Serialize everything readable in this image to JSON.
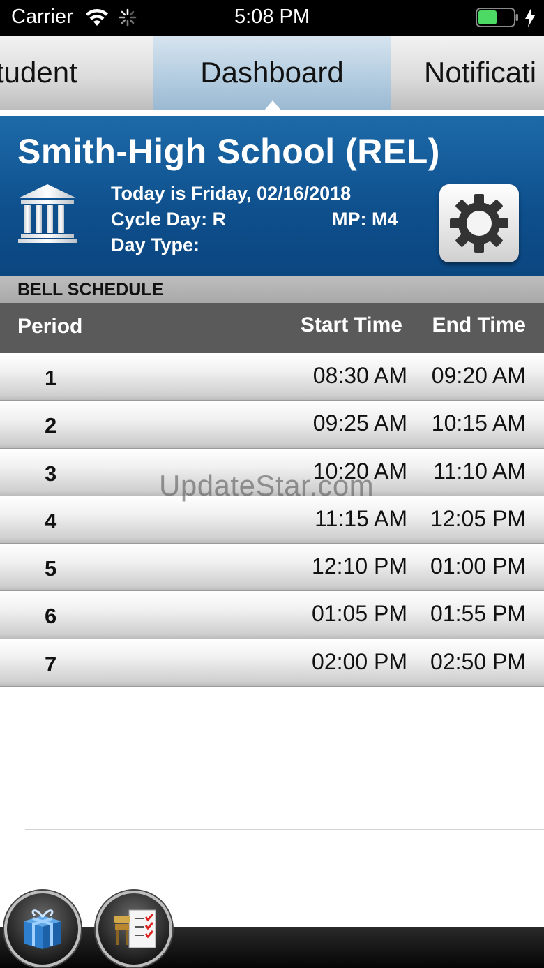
{
  "status_bar": {
    "carrier": "Carrier",
    "time": "5:08 PM",
    "battery_color": "#4cd964"
  },
  "tabs": [
    {
      "label": "tudent"
    },
    {
      "label": "Dashboard",
      "selected": true
    },
    {
      "label": "Notificati"
    }
  ],
  "school": {
    "name": "Smith-High School (REL)",
    "today": "Today is Friday, 02/16/2018",
    "cycle_day": "Cycle Day: R",
    "marking_period": "MP: M4",
    "day_type": "Day Type:",
    "header_color": "#0e4f8c"
  },
  "bell_schedule": {
    "section_title": "BELL SCHEDULE",
    "columns": {
      "period": "Period",
      "start": "Start Time",
      "end": "End Time"
    },
    "rows": [
      {
        "period": "1",
        "start": "08:30 AM",
        "end": "09:20 AM"
      },
      {
        "period": "2",
        "start": "09:25 AM",
        "end": "10:15 AM"
      },
      {
        "period": "3",
        "start": "10:20 AM",
        "end": "11:10 AM"
      },
      {
        "period": "4",
        "start": "11:15 AM",
        "end": "12:05 PM"
      },
      {
        "period": "5",
        "start": "12:10 PM",
        "end": "01:00 PM"
      },
      {
        "period": "6",
        "start": "01:05 PM",
        "end": "01:55 PM"
      },
      {
        "period": "7",
        "start": "02:00 PM",
        "end": "02:50 PM"
      }
    ]
  },
  "watermark": "UpdateStar.com",
  "icons": {
    "building": "building-icon",
    "settings": "gear-icon",
    "gift": "gift-icon",
    "checklist": "checklist-icon"
  }
}
